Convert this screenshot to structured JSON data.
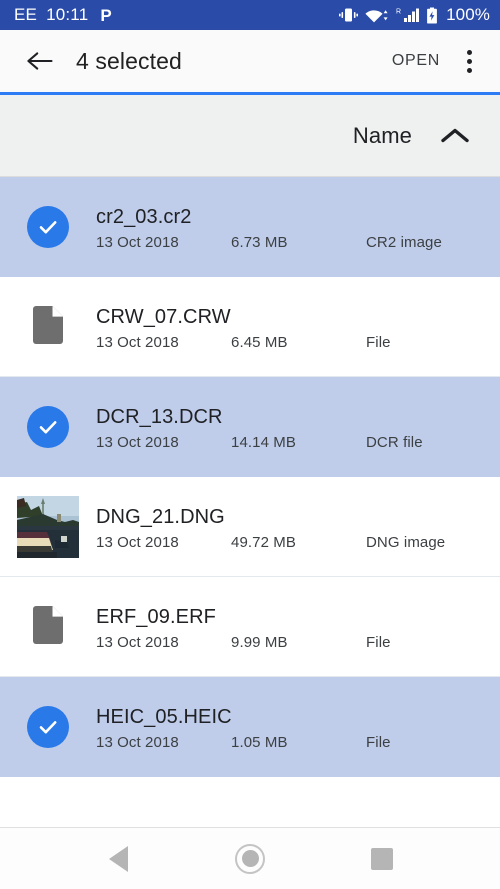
{
  "status_bar": {
    "carrier": "EE",
    "clock": "10:11",
    "app_icon": "P",
    "icons": [
      "vibrate-icon",
      "wifi-icon",
      "signal-icon",
      "battery-icon"
    ],
    "roaming_indicator": "R",
    "battery_percent": "100%",
    "background_color": "#2a4ba8"
  },
  "toolbar": {
    "back_label": "back-arrow",
    "title": "4 selected",
    "open_label": "OPEN",
    "overflow_label": "more-options",
    "accent_color": "#2d7cf6",
    "background_color": "#fafafa"
  },
  "sort_bar": {
    "label": "Name",
    "direction": "ascending",
    "background_color": "#eff0f0"
  },
  "file_list": {
    "selected_row_color": "#bfcdeb",
    "checkbox_color": "#2979e8",
    "columns": [
      "name",
      "date",
      "size",
      "type"
    ],
    "rows": [
      {
        "name": "cr2_03.cr2",
        "date": "13 Oct 2018",
        "size": "6.73 MB",
        "type": "CR2 image",
        "selected": true,
        "icon": "check-circle-icon"
      },
      {
        "name": "CRW_07.CRW",
        "date": "13 Oct 2018",
        "size": "6.45 MB",
        "type": "File",
        "selected": false,
        "icon": "document-icon"
      },
      {
        "name": "DCR_13.DCR",
        "date": "13 Oct 2018",
        "size": "14.14 MB",
        "type": "DCR file",
        "selected": true,
        "icon": "check-circle-icon"
      },
      {
        "name": "DNG_21.DNG",
        "date": "13 Oct 2018",
        "size": "49.72 MB",
        "type": "DNG image",
        "selected": false,
        "icon": "photo-thumbnail"
      },
      {
        "name": "ERF_09.ERF",
        "date": "13 Oct 2018",
        "size": "9.99 MB",
        "type": "File",
        "selected": false,
        "icon": "document-icon"
      },
      {
        "name": "HEIC_05.HEIC",
        "date": "13 Oct 2018",
        "size": "1.05 MB",
        "type": "File",
        "selected": true,
        "icon": "check-circle-icon"
      }
    ]
  },
  "nav_bar": {
    "back_label": "back",
    "home_label": "home",
    "recents_label": "recents"
  }
}
